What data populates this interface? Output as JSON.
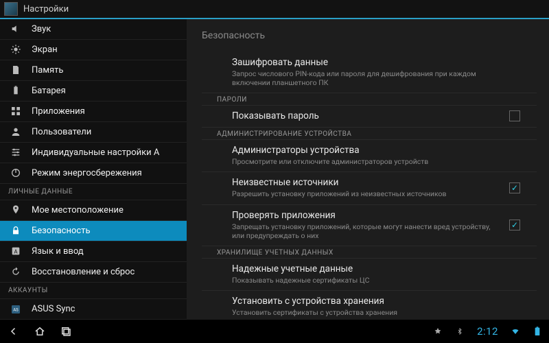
{
  "app_title": "Настройки",
  "sidebar": {
    "items_top": [
      {
        "label": "Звук",
        "icon": "volume"
      },
      {
        "label": "Экран",
        "icon": "brightness"
      },
      {
        "label": "Память",
        "icon": "sd"
      },
      {
        "label": "Батарея",
        "icon": "battery"
      },
      {
        "label": "Приложения",
        "icon": "apps"
      },
      {
        "label": "Пользователи",
        "icon": "user"
      },
      {
        "label": "Индивидуальные настройки A",
        "icon": "tune"
      },
      {
        "label": "Режим энергосбережения",
        "icon": "power"
      }
    ],
    "section_personal": "ЛИЧНЫЕ ДАННЫЕ",
    "items_personal": [
      {
        "label": "Мое местоположение",
        "icon": "location"
      },
      {
        "label": "Безопасность",
        "icon": "lock",
        "selected": true
      },
      {
        "label": "Язык и ввод",
        "icon": "lang"
      },
      {
        "label": "Восстановление и сброс",
        "icon": "reset"
      }
    ],
    "section_accounts": "АККАУНТЫ",
    "items_accounts": [
      {
        "label": "ASUS Sync",
        "icon": "asus"
      }
    ]
  },
  "detail": {
    "title": "Безопасность",
    "rows": [
      {
        "kind": "item",
        "title": "Зашифровать данные",
        "sub": "Запрос числового PIN-кода или пароля для дешифрования при каждом включении планшетного ПК"
      },
      {
        "kind": "section",
        "label": "ПАРОЛИ"
      },
      {
        "kind": "check",
        "title": "Показывать пароль",
        "checked": false
      },
      {
        "kind": "section",
        "label": "АДМИНИСТРИРОВАНИЕ УСТРОЙСТВА"
      },
      {
        "kind": "item",
        "title": "Администраторы устройства",
        "sub": "Просмотрите или отключите администраторов устройств"
      },
      {
        "kind": "check",
        "title": "Неизвестные источники",
        "sub": "Разрешить установку приложений из неизвестных источников",
        "checked": true
      },
      {
        "kind": "check",
        "title": "Проверять приложения",
        "sub": "Запрещать установку приложений, которые могут нанести вред устройству, или предупреждать о них",
        "checked": true
      },
      {
        "kind": "section",
        "label": "ХРАНИЛИЩЕ УЧЕТНЫХ ДАННЫХ"
      },
      {
        "kind": "item",
        "title": "Надежные учетные данные",
        "sub": "Показывать надежные сертификаты ЦС"
      },
      {
        "kind": "item",
        "title": "Установить с устройства хранения",
        "sub": "Установить сертификаты с устройства хранения"
      }
    ]
  },
  "statusbar": {
    "clock": "2:12"
  }
}
